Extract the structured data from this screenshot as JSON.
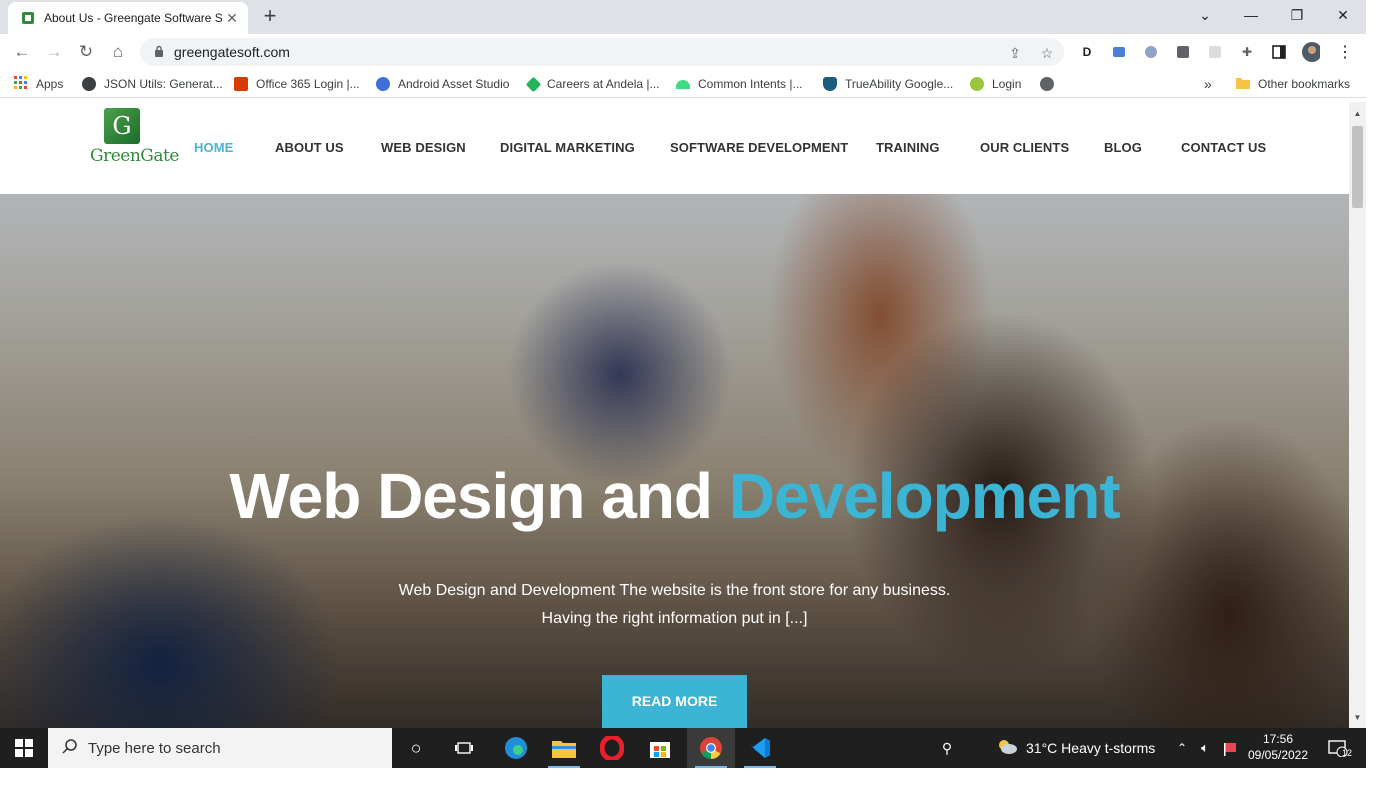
{
  "browser": {
    "tab_title": "About Us - Greengate Software S",
    "url": "greengatesoft.com",
    "bookmarks": [
      {
        "label": "Apps",
        "icon": "apps-grid-icon"
      },
      {
        "label": "JSON Utils: Generat...",
        "icon": "json-utils-icon"
      },
      {
        "label": "Office 365 Login |...",
        "icon": "office-icon"
      },
      {
        "label": "Android Asset Studio",
        "icon": "android-studio-icon"
      },
      {
        "label": "Careers at Andela |...",
        "icon": "andela-icon"
      },
      {
        "label": "Common Intents |...",
        "icon": "android-icon"
      },
      {
        "label": "TrueAbility Google...",
        "icon": "trueability-icon"
      },
      {
        "label": "Login",
        "icon": "login-icon"
      }
    ],
    "bookmarks_overflow": "»",
    "other_bookmarks": "Other bookmarks"
  },
  "site": {
    "logo_text": "GreenGate",
    "logo_mark": "G",
    "nav": [
      {
        "label": "HOME",
        "active": true
      },
      {
        "label": "ABOUT US",
        "active": false
      },
      {
        "label": "WEB DESIGN",
        "active": false
      },
      {
        "label": "DIGITAL MARKETING",
        "active": false
      },
      {
        "label": "SOFTWARE DEVELOPMENT",
        "active": false
      },
      {
        "label": "TRAINING",
        "active": false
      },
      {
        "label": "OUR CLIENTS",
        "active": false
      },
      {
        "label": "BLOG",
        "active": false
      },
      {
        "label": "CONTACT US",
        "active": false
      }
    ],
    "hero": {
      "title_white": "Web Design and",
      "title_accent": "Development",
      "subtitle_line1": "Web Design and Development The website is the front store for any business.",
      "subtitle_line2": "Having the right information put in [...]",
      "button": "READ MORE"
    }
  },
  "taskbar": {
    "search_placeholder": "Type here to search",
    "weather": "31°C  Heavy t-storms",
    "time": "17:56",
    "date": "09/05/2022",
    "notifications": "12"
  },
  "colors": {
    "accent": "#3cb4d3",
    "brand_green": "#2f8a3a",
    "whatsapp": "#25d366"
  }
}
